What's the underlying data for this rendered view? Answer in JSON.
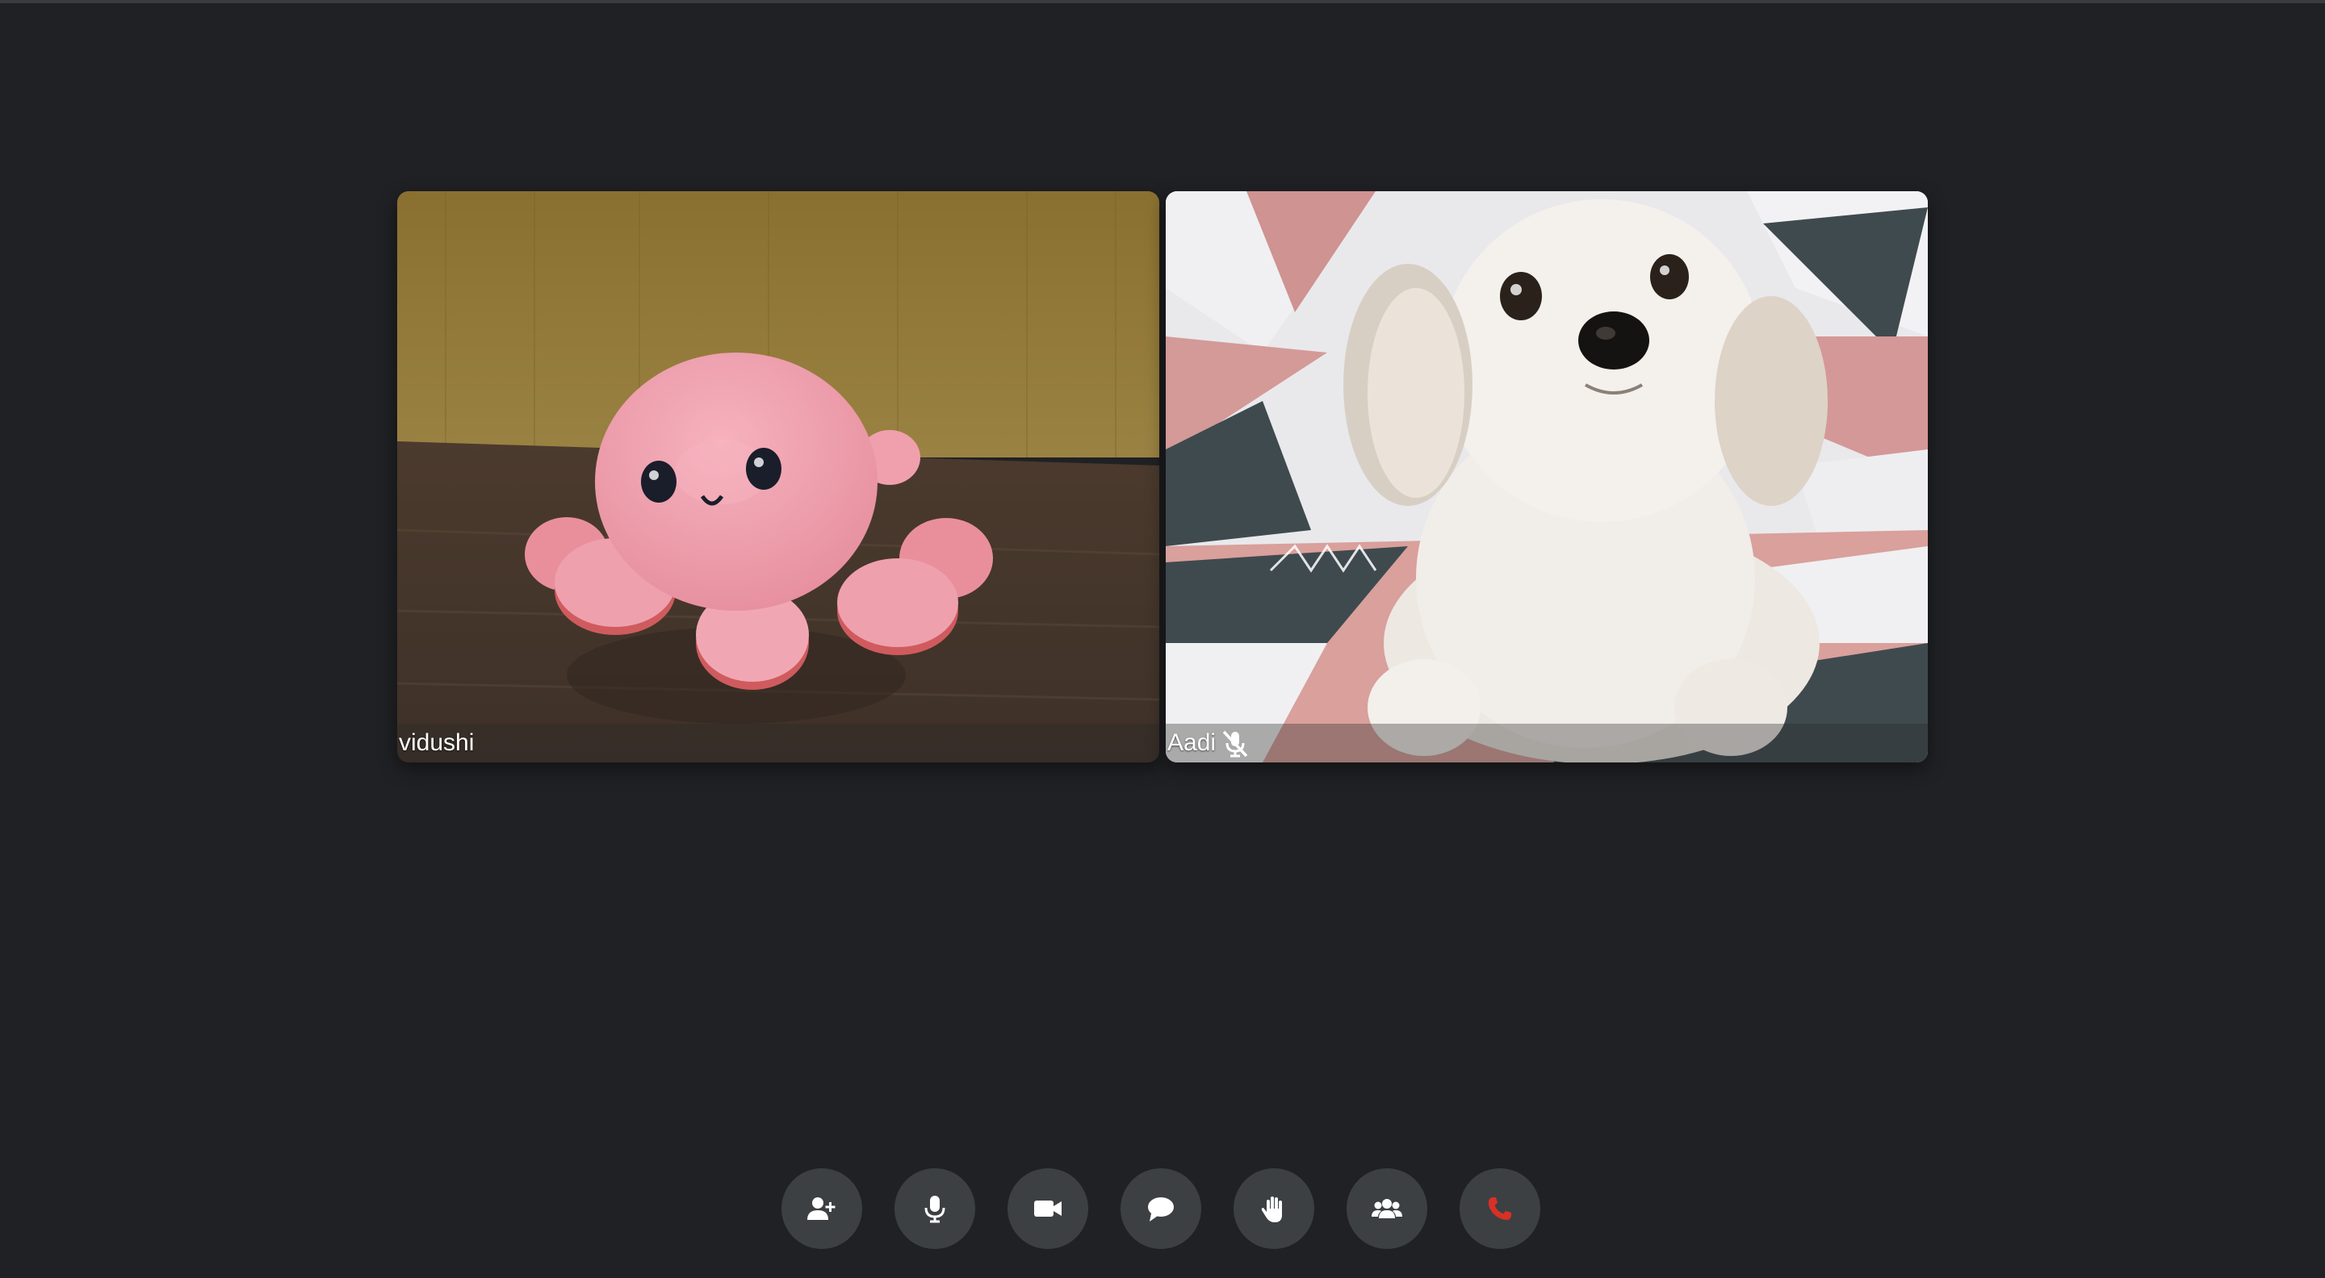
{
  "participants": [
    {
      "name": "vidushi",
      "muted": false,
      "video": "pink-octopus-plush"
    },
    {
      "name": "Aadi",
      "muted": true,
      "video": "white-dog"
    }
  ],
  "controls": [
    {
      "icon": "add-person-icon",
      "color": "#ffffff"
    },
    {
      "icon": "microphone-icon",
      "color": "#ffffff"
    },
    {
      "icon": "video-camera-icon",
      "color": "#ffffff"
    },
    {
      "icon": "chat-bubble-icon",
      "color": "#ffffff"
    },
    {
      "icon": "raise-hand-icon",
      "color": "#ffffff"
    },
    {
      "icon": "participants-icon",
      "color": "#ffffff"
    },
    {
      "icon": "end-call-icon",
      "color": "#d93025"
    }
  ],
  "colors": {
    "background": "#202124",
    "button_background": "#3c4043",
    "end_call": "#d93025"
  }
}
